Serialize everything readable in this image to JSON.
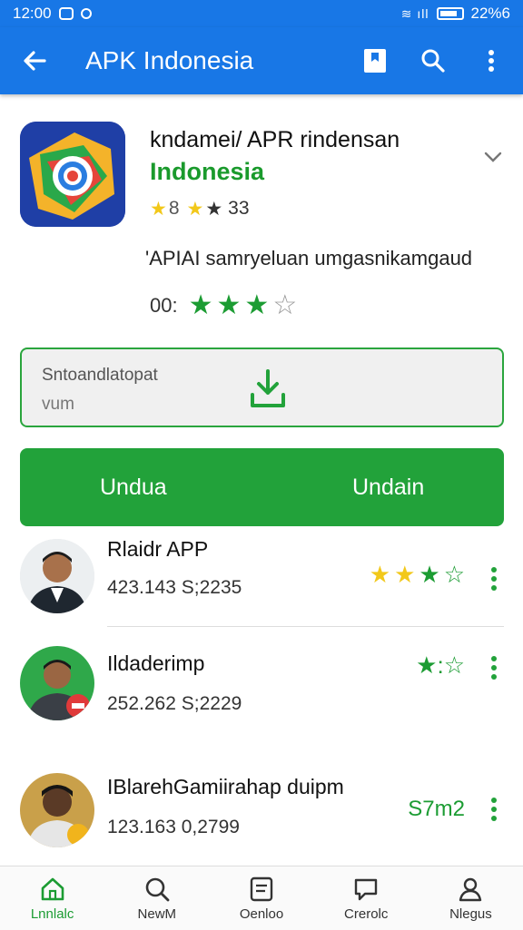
{
  "status": {
    "time": "12:00",
    "right_text": "22%6"
  },
  "appbar": {
    "title": "APK Indonesia"
  },
  "app": {
    "name": "kndamei/ APR rindensan",
    "subtitle": "Indonesia",
    "rating_value": "8",
    "rating_count": "33",
    "description": "'APIAI samryeluan umgasnikamgaud",
    "score_label": "00:",
    "score_stars": 3,
    "score_max": 5
  },
  "download_box": {
    "line1": "Sntoandlatopat",
    "line2": "vum"
  },
  "primary_button": {
    "left_label": "Undua",
    "right_label": "Undain"
  },
  "list": [
    {
      "title": "Rlaidr APP",
      "meta": "423.143  S;2235",
      "rating": "3 of 4 stars",
      "stars_filled": 3,
      "stars_total": 4
    },
    {
      "title": "Ildaderimp",
      "meta": "252.262  S;2229",
      "rating": "★:☆"
    },
    {
      "title": "IBlarehGamiirahap duipm",
      "meta": "123.163  0,2799",
      "rating": "S7m2"
    }
  ],
  "bottom_nav": [
    {
      "label": "Lnnlalc",
      "icon": "home-icon"
    },
    {
      "label": "NewM",
      "icon": "search-icon"
    },
    {
      "label": "Oenloo",
      "icon": "document-icon"
    },
    {
      "label": "Crerolc",
      "icon": "chat-icon"
    },
    {
      "label": "Nlegus",
      "icon": "profile-icon"
    }
  ],
  "colors": {
    "primary_blue": "#1877e6",
    "accent_green": "#22a23a",
    "star_yellow": "#f2c81a"
  }
}
